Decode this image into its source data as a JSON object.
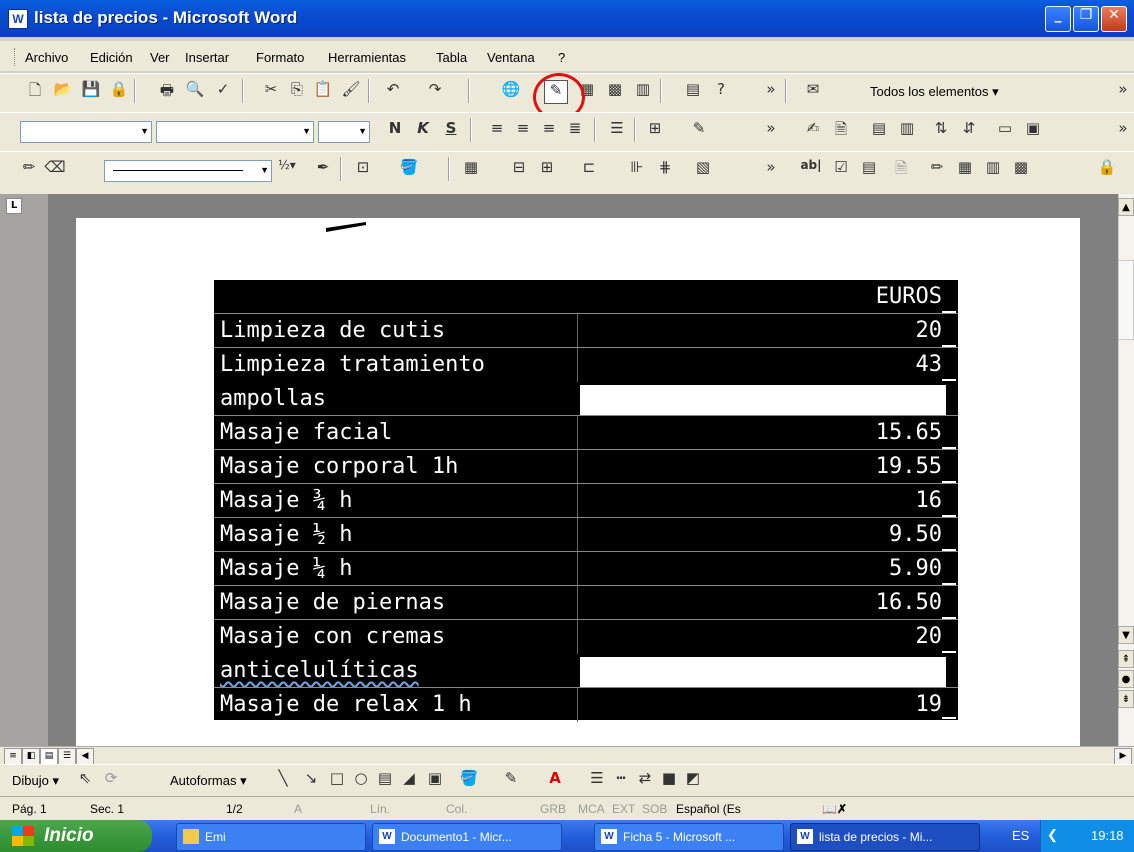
{
  "window": {
    "title": "lista de precios - Microsoft Word",
    "icon": "word-doc-icon",
    "controls": [
      "minimize",
      "restore",
      "close"
    ]
  },
  "menu": {
    "items": [
      "Archivo",
      "Edición",
      "Ver",
      "Insertar",
      "Formato",
      "Herramientas",
      "Tabla",
      "Ventana",
      "?"
    ]
  },
  "toolbar_standard": {
    "zoom_selector": "Todos los elementos",
    "highlight_color": "#e01010"
  },
  "toolbar_format": {
    "style": "",
    "font": "",
    "size": "",
    "bold_label": "N",
    "italic_label": "K",
    "underline_label": "S"
  },
  "toolbar_tables": {
    "line_weight": "½"
  },
  "table": {
    "header": {
      "name": "",
      "price": "EUROS"
    },
    "rows": [
      {
        "name": "Limpieza de cutis",
        "price": "20"
      },
      {
        "name": "Limpieza tratamiento",
        "price": "43"
      },
      {
        "name": "ampollas",
        "price": ""
      },
      {
        "name": "Masaje facial",
        "price": "15.65"
      },
      {
        "name": "Masaje corporal  1h",
        "price": "19.55"
      },
      {
        "name": "Masaje ¾ h",
        "price": "16"
      },
      {
        "name": "Masaje ½ h",
        "price": "9.50"
      },
      {
        "name": "Masaje ¼ h",
        "price": "5.90"
      },
      {
        "name": "Masaje de piernas",
        "price": "16.50"
      },
      {
        "name": "Masaje con cremas",
        "price": "20"
      },
      {
        "name": "anticelulíticas",
        "price": ""
      },
      {
        "name": "Masaje de relax 1 h",
        "price": "19"
      }
    ]
  },
  "drawing_toolbar": {
    "draw_label": "Dibujo",
    "autoshapes_label": "Autoformas"
  },
  "status": {
    "page": "Pág. 1",
    "section": "Sec. 1",
    "pages": "1/2",
    "at": "A",
    "line": "Lín.",
    "col": "Col.",
    "grb": "GRB",
    "mca": "MCA",
    "ext": "EXT",
    "sob": "SOB",
    "language": "Español (Es"
  },
  "taskbar": {
    "start_label": "Inicio",
    "tasks": [
      {
        "label": "Emi",
        "icon": "folder-icon"
      },
      {
        "label": "Documento1 - Micr...",
        "icon": "word-doc-icon"
      },
      {
        "label": "Ficha 5 - Microsoft ...",
        "icon": "word-doc-icon"
      },
      {
        "label": "lista de precios - Mi...",
        "icon": "word-doc-icon"
      }
    ],
    "lang": "ES",
    "clock": "19:18"
  }
}
